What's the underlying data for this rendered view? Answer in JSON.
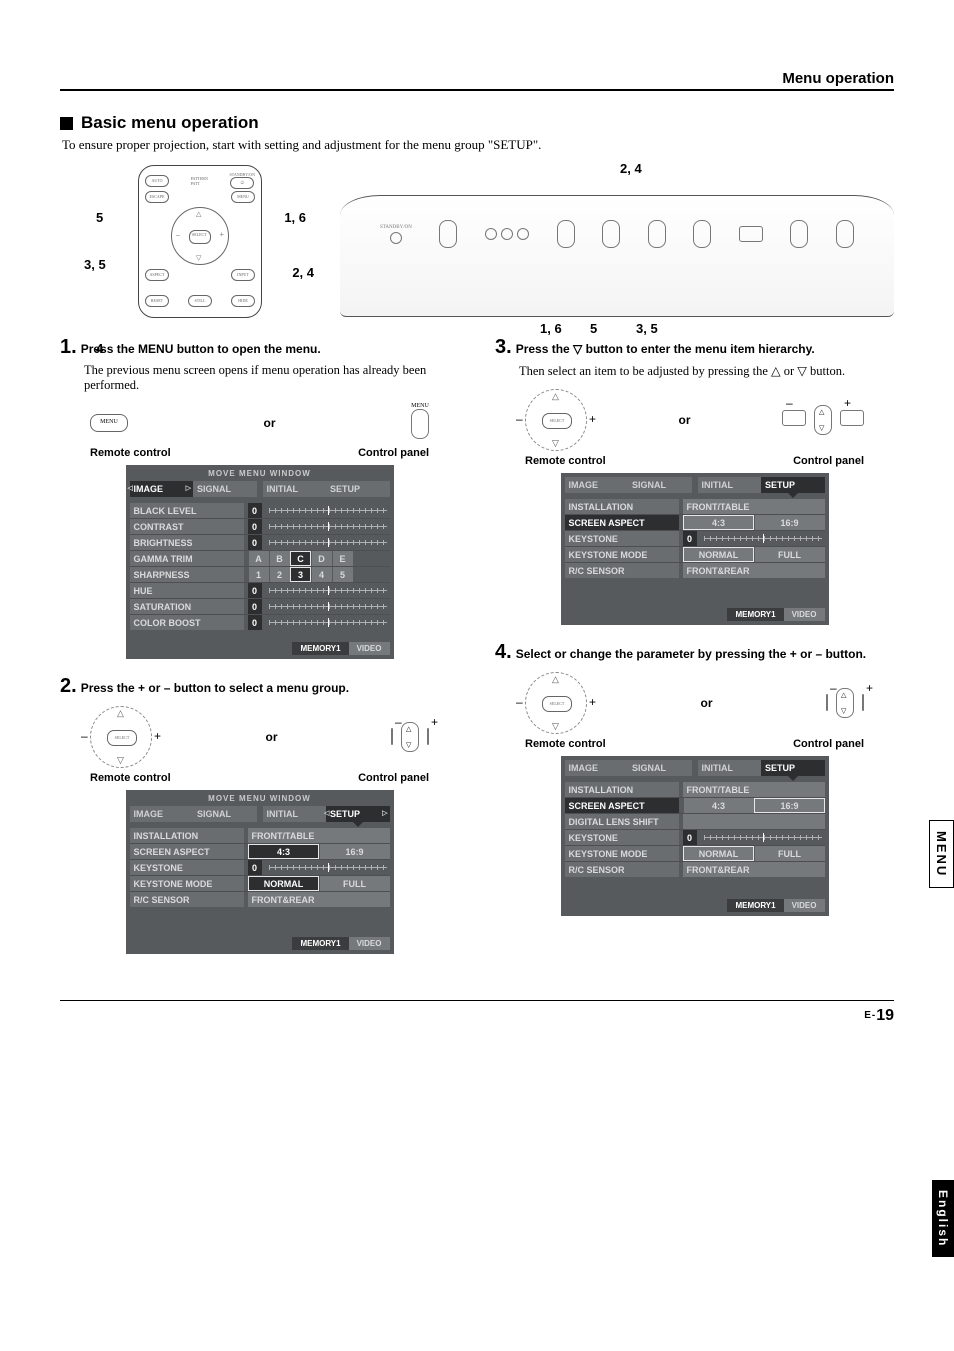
{
  "header": {
    "section": "Menu operation"
  },
  "title": "Basic menu operation",
  "intro": "To ensure proper projection, start with setting and adjustment for the menu group \"SETUP\".",
  "remote_callouts": {
    "topleft": "5",
    "topright": "1, 6",
    "midleft": "3, 5",
    "midright": "2, 4",
    "botleft": "4"
  },
  "panel_callouts": {
    "top": "2, 4",
    "b1": "1, 6",
    "b2": "5",
    "b3": "3, 5"
  },
  "labels": {
    "remote": "Remote control",
    "panel": "Control panel",
    "or": "or",
    "menu": "MENU",
    "select": "SELECT",
    "plus": "+",
    "minus": "–",
    "move_window": "MOVE MENU WINDOW",
    "memory": "MEMORY1",
    "video": "VIDEO"
  },
  "steps": [
    {
      "num": "1.",
      "head": "Press the MENU button to open the menu.",
      "body": "The previous menu screen opens if menu operation has already been performed."
    },
    {
      "num": "2.",
      "head": "Press the + or – button to select a menu group.",
      "body": ""
    },
    {
      "num": "3.",
      "head": "Press the ▽ button to enter the menu item hierarchy.",
      "body": "Then select an item to be adjusted by pressing the △ or ▽ button."
    },
    {
      "num": "4.",
      "head": "Select or change the parameter by pressing the + or – button.",
      "body": ""
    }
  ],
  "tabs": {
    "image": "IMAGE",
    "signal": "SIGNAL",
    "initial": "INITIAL",
    "setup": "SETUP"
  },
  "menu_image": {
    "rows": [
      {
        "label": "BLACK LEVEL",
        "val": "0",
        "knob": 50
      },
      {
        "label": "CONTRAST",
        "val": "0",
        "knob": 50
      },
      {
        "label": "BRIGHTNESS",
        "val": "0",
        "knob": 50
      },
      {
        "label": "GAMMA TRIM",
        "opts": [
          "A",
          "B",
          "C",
          "D",
          "E"
        ],
        "sel_idx": 2
      },
      {
        "label": "SHARPNESS",
        "opts": [
          "1",
          "2",
          "3",
          "4",
          "5"
        ],
        "sel_idx": 2
      },
      {
        "label": "HUE",
        "val": "0",
        "knob": 50
      },
      {
        "label": "SATURATION",
        "val": "0",
        "knob": 50
      },
      {
        "label": "COLOR BOOST",
        "val": "0",
        "knob": 50
      }
    ]
  },
  "menu_setup_a": {
    "rows": [
      {
        "label": "INSTALLATION",
        "text": "FRONT/TABLE"
      },
      {
        "label": "SCREEN ASPECT",
        "opts": [
          "4:3",
          "16:9"
        ],
        "sel_idx": 0
      },
      {
        "label": "KEYSTONE",
        "val": "0",
        "knob": 50
      },
      {
        "label": "KEYSTONE MODE",
        "opts": [
          "NORMAL",
          "FULL"
        ],
        "sel_idx": 0
      },
      {
        "label": "R/C SENSOR",
        "text": "FRONT&REAR"
      }
    ]
  },
  "menu_setup_b": {
    "rows": [
      {
        "label": "INSTALLATION",
        "text": "FRONT/TABLE"
      },
      {
        "label": "SCREEN ASPECT",
        "opts": [
          "4:3",
          "16:9"
        ],
        "sel_idx": 0,
        "highlight_label": true
      },
      {
        "label": "KEYSTONE",
        "val": "0",
        "knob": 50
      },
      {
        "label": "KEYSTONE MODE",
        "opts": [
          "NORMAL",
          "FULL"
        ],
        "sel_idx": 0
      },
      {
        "label": "R/C SENSOR",
        "text": "FRONT&REAR"
      }
    ]
  },
  "menu_setup_c": {
    "rows": [
      {
        "label": "INSTALLATION",
        "text": "FRONT/TABLE"
      },
      {
        "label": "SCREEN ASPECT",
        "opts": [
          "4:3",
          "16:9"
        ],
        "sel_idx": 1,
        "highlight_label": true
      },
      {
        "label": "DIGITAL LENS SHIFT",
        "text": ""
      },
      {
        "label": "KEYSTONE",
        "val": "0",
        "knob": 50
      },
      {
        "label": "KEYSTONE MODE",
        "opts": [
          "NORMAL",
          "FULL"
        ],
        "sel_idx": 0
      },
      {
        "label": "R/C SENSOR",
        "text": "FRONT&REAR"
      }
    ]
  },
  "side": {
    "menu": "MENU",
    "lang": "English"
  },
  "page": {
    "prefix": "E-",
    "num": "19"
  }
}
